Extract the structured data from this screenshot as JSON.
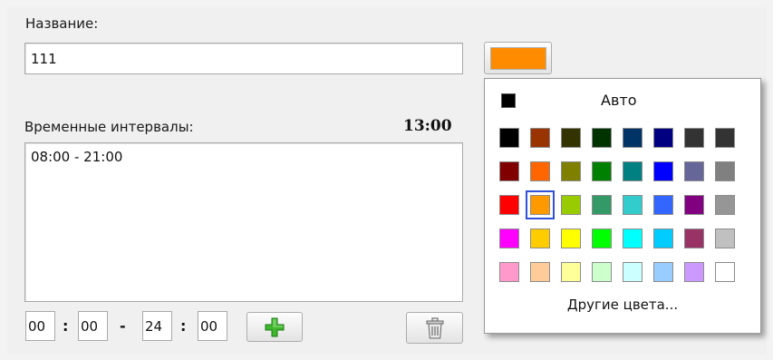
{
  "form": {
    "name_label": "Название:",
    "name_value": "111",
    "intervals_label": "Временные интервалы:",
    "current_time": "13:00",
    "intervals": [
      "08:00 - 21:00"
    ],
    "time_from_h": "00",
    "time_from_m": "00",
    "time_to_h": "24",
    "time_to_m": "00",
    "colon": ":",
    "dash": "-",
    "add_icon": "plus-icon",
    "delete_icon": "trash-icon"
  },
  "color_picker": {
    "selected_color": "#ff8c00",
    "auto_label": "Авто",
    "auto_color": "#000000",
    "other_label": "Другие цвета...",
    "rows": [
      [
        "#000000",
        "#993300",
        "#333300",
        "#003300",
        "#003366",
        "#000080",
        "#333333",
        "#333333"
      ],
      [
        "#800000",
        "#ff6600",
        "#808000",
        "#008000",
        "#008080",
        "#0000ff",
        "#666699",
        "#808080"
      ],
      [
        "#ff0000",
        "#ff9900",
        "#99cc00",
        "#339966",
        "#33cccc",
        "#3366ff",
        "#800080",
        "#969696"
      ],
      [
        "#ff00ff",
        "#ffcc00",
        "#ffff00",
        "#00ff00",
        "#00ffff",
        "#00ccff",
        "#993366",
        "#c0c0c0"
      ],
      [
        "#ff99cc",
        "#ffcc99",
        "#ffff99",
        "#ccffcc",
        "#ccffff",
        "#99ccff",
        "#cc99ff",
        "#ffffff"
      ]
    ],
    "selected_cell": [
      2,
      1
    ]
  }
}
